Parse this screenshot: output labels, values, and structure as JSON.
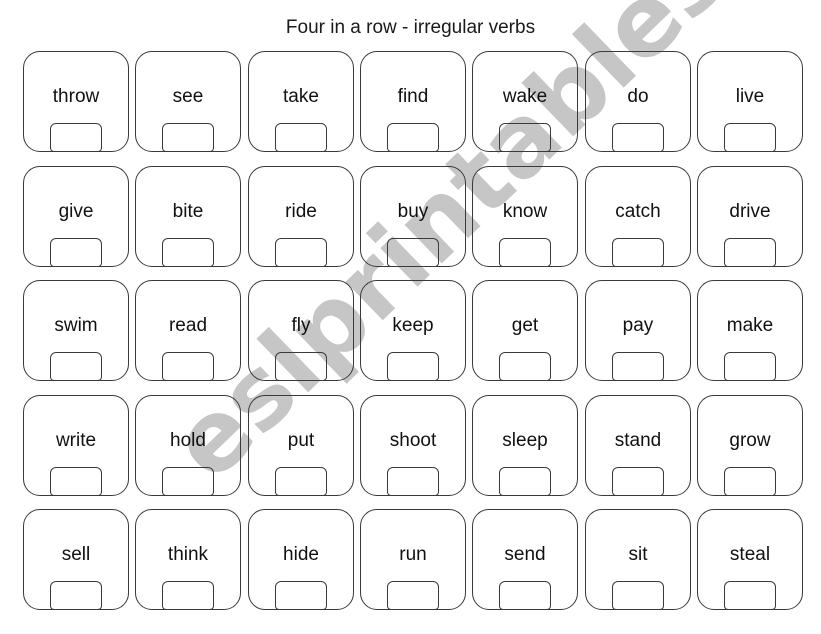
{
  "page": {
    "title": "Four in a row - irregular verbs"
  },
  "board": {
    "rows": [
      [
        "throw",
        "see",
        "take",
        "find",
        "wake",
        "do",
        "live"
      ],
      [
        "give",
        "bite",
        "ride",
        "buy",
        "know",
        "catch",
        "drive"
      ],
      [
        "swim",
        "read",
        "fly",
        "keep",
        "get",
        "pay",
        "make"
      ],
      [
        "write",
        "hold",
        "put",
        "shoot",
        "sleep",
        "stand",
        "grow"
      ],
      [
        "sell",
        "think",
        "hide",
        "run",
        "send",
        "sit",
        "steal"
      ]
    ]
  },
  "watermark": {
    "text": "eslprintables.com",
    "color": "#c4c4c4"
  },
  "colors": {
    "card_border": "#3a3a3a",
    "text": "#111111",
    "background": "#ffffff"
  }
}
